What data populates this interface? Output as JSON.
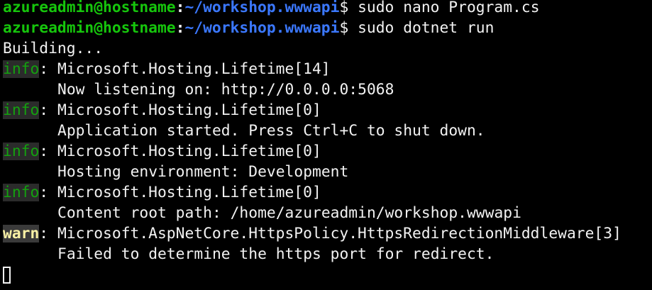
{
  "terminal": {
    "prompts": [
      {
        "user_host": "azureadmin@hostname",
        "separator": ":",
        "path": "~/workshop.wwwapi",
        "symbol": "$",
        "command": " sudo nano Program.cs"
      },
      {
        "user_host": "azureadmin@hostname",
        "separator": ":",
        "path": "~/workshop.wwwapi",
        "symbol": "$",
        "command": " sudo dotnet run"
      }
    ],
    "building": "Building...",
    "logs": [
      {
        "level": "info",
        "source": ": Microsoft.Hosting.Lifetime[14]",
        "message": "Now listening on: http://0.0.0.0:5068"
      },
      {
        "level": "info",
        "source": ": Microsoft.Hosting.Lifetime[0]",
        "message": "Application started. Press Ctrl+C to shut down."
      },
      {
        "level": "info",
        "source": ": Microsoft.Hosting.Lifetime[0]",
        "message": "Hosting environment: Development"
      },
      {
        "level": "info",
        "source": ": Microsoft.Hosting.Lifetime[0]",
        "message": "Content root path: /home/azureadmin/workshop.wwwapi"
      },
      {
        "level": "warn",
        "source": ": Microsoft.AspNetCore.HttpsPolicy.HttpsRedirectionMiddleware[3]",
        "message": "Failed to determine the https port for redirect."
      }
    ],
    "colors": {
      "background": "#000000",
      "foreground": "#f2f2f2",
      "user_host": "#16c60c",
      "path": "#3b78ff",
      "info": "#13a10e",
      "warn": "#f9f1a5"
    }
  }
}
